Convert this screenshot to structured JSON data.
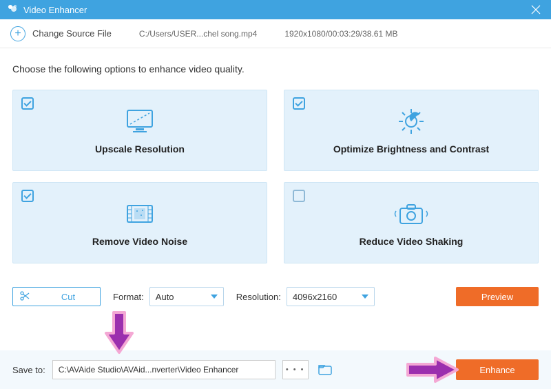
{
  "titlebar": {
    "title": "Video Enhancer"
  },
  "toolbar": {
    "change_source_label": "Change Source File",
    "file_path": "C:/Users/USER...chel song.mp4",
    "file_info": "1920x1080/00:03:29/38.61 MB"
  },
  "instructions": "Choose the following options to enhance video quality.",
  "options": [
    {
      "label": "Upscale Resolution",
      "checked": true
    },
    {
      "label": "Optimize Brightness and Contrast",
      "checked": true
    },
    {
      "label": "Remove Video Noise",
      "checked": true
    },
    {
      "label": "Reduce Video Shaking",
      "checked": false
    }
  ],
  "controls": {
    "cut_label": "Cut",
    "format_label": "Format:",
    "format_value": "Auto",
    "resolution_label": "Resolution:",
    "resolution_value": "4096x2160",
    "preview_label": "Preview"
  },
  "save": {
    "label": "Save to:",
    "path": "C:\\AVAide Studio\\AVAid...nverter\\Video Enhancer",
    "browse_label": "• • •",
    "enhance_label": "Enhance"
  }
}
